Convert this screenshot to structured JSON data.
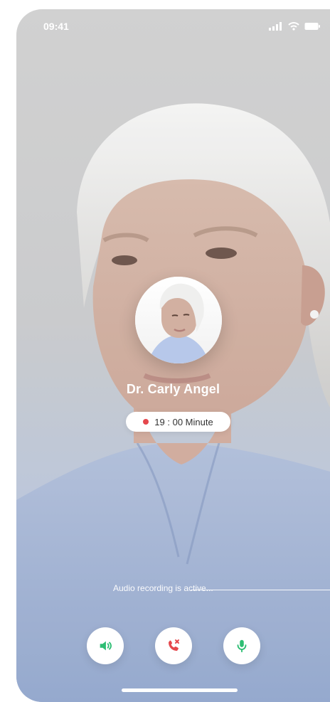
{
  "status_bar": {
    "time": "09:41"
  },
  "call": {
    "caller_name": "Dr. Carly Angel",
    "timer": "19 : 00 Minute",
    "recording_text": "Audio recording is active..."
  },
  "controls": [
    {
      "name": "speaker",
      "icon": "speaker-icon",
      "color": "#2DBE73"
    },
    {
      "name": "end-call",
      "icon": "end-call-icon",
      "color": "#E5484D"
    },
    {
      "name": "microphone",
      "icon": "microphone-icon",
      "color": "#2DBE73"
    }
  ],
  "colors": {
    "accent_green": "#2DBE73",
    "danger_red": "#E5484D"
  }
}
